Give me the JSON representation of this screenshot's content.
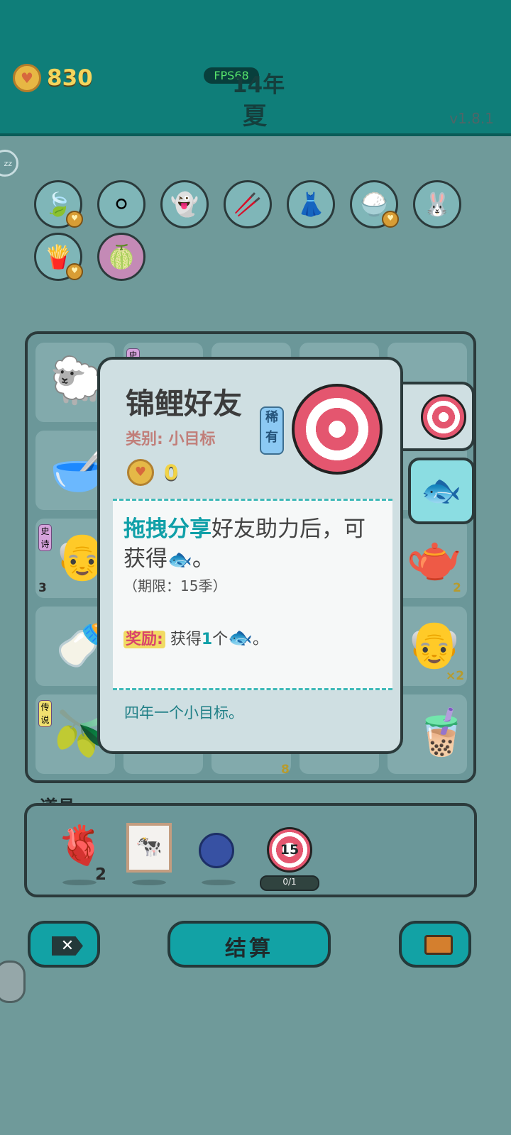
{
  "top": {
    "coins": "830",
    "fps": "FPS68",
    "year": "14年",
    "season": "夏",
    "version": "v1.8.1"
  },
  "side_toggle_text": "zz",
  "modal": {
    "title": "锦鲤好友",
    "category": "类别: 小目标",
    "rarity": "稀有",
    "coins": "0",
    "desc_part1_em": "拖拽分享",
    "desc_part1_rest": "好友助力后，可",
    "desc_part2": "获得",
    "desc_part2_end": "。",
    "limit": "（期限：15季）",
    "reward_label": "奖励:",
    "reward_text_a": "获得",
    "reward_text_one": "1",
    "reward_text_b": "个",
    "reward_text_end": "。",
    "flavor": "四年一个小目标。"
  },
  "board": {
    "tag_legend": "传说",
    "tag_poem": "史诗",
    "counts": [
      "3",
      "2",
      "×2",
      "8"
    ]
  },
  "props": {
    "label": "道具",
    "liver_count": "2",
    "target_number": "15",
    "progress": "0/1"
  },
  "buttons": {
    "settle": "结算"
  },
  "icons": [
    "leaf-icon",
    "egg-tray-icon",
    "ghost-icon",
    "chopsticks-icon",
    "skirt-icon",
    "rice-bowl-icon",
    "rabbit-icon",
    "fries-icon",
    "grapefruit-icon"
  ]
}
